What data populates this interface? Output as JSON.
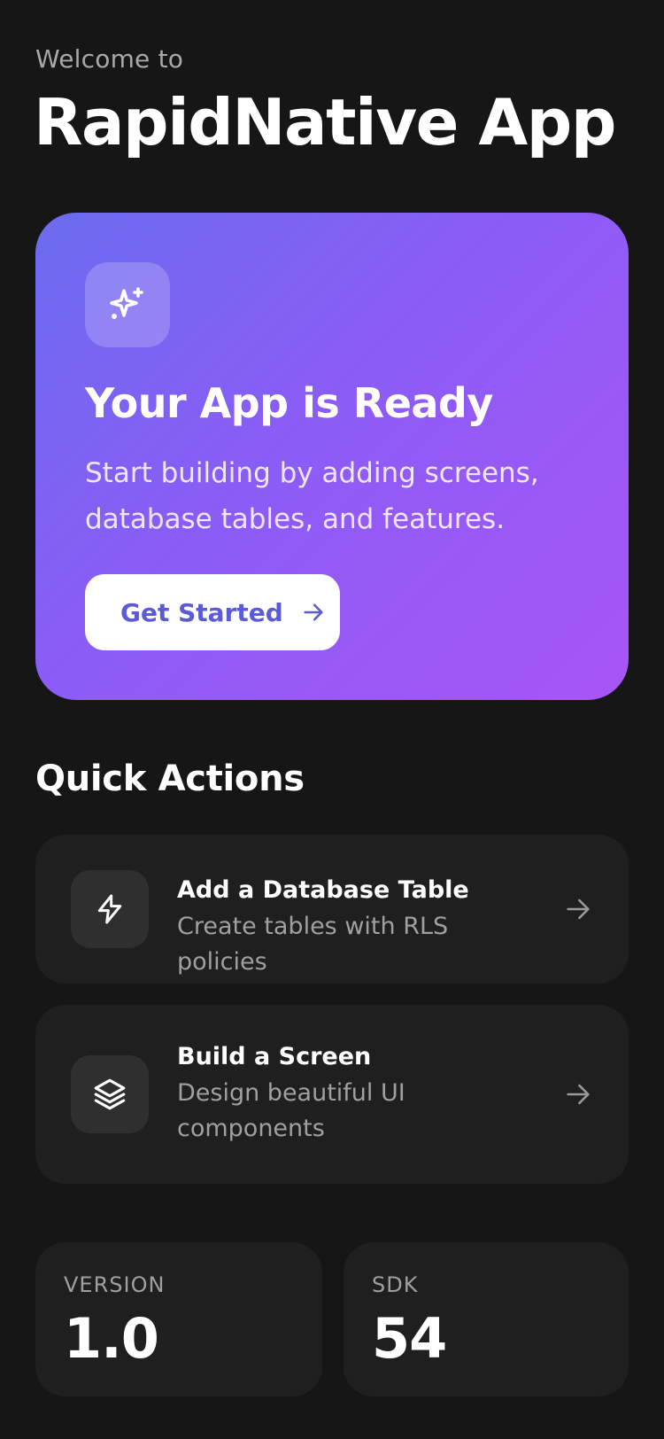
{
  "header": {
    "welcome": "Welcome to",
    "title": "RapidNative App"
  },
  "hero": {
    "icon": "sparkles-icon",
    "title": "Your App is Ready",
    "description": "Start building by adding screens, database tables, and features.",
    "cta_label": "Get Started",
    "cta_icon": "arrow-right-icon",
    "gradient_start": "#6b6cf0",
    "gradient_end": "#a855f7"
  },
  "quick_actions": {
    "title": "Quick Actions",
    "items": [
      {
        "icon": "lightning-icon",
        "title": "Add a Database Table",
        "subtitle": "Create tables with RLS policies"
      },
      {
        "icon": "layers-icon",
        "title": "Build a Screen",
        "subtitle": "Design beautiful UI components"
      }
    ]
  },
  "stats": [
    {
      "label": "VERSION",
      "value": "1.0"
    },
    {
      "label": "SDK",
      "value": "54"
    }
  ],
  "colors": {
    "background": "#161616",
    "card": "#1f1f1f",
    "accent": "#5b5bd6"
  }
}
